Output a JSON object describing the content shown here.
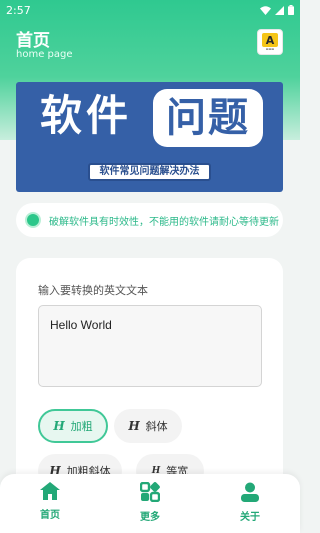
{
  "status_bar": {
    "time": "2:57"
  },
  "header": {
    "title": "首页",
    "subtitle": "home page",
    "logo_letter": "A"
  },
  "banner": {
    "main_left": "软件",
    "main_box": "问题",
    "subtitle": "软件常见问题解决办法"
  },
  "notice": {
    "text": "破解软件具有时效性，不能用的软件请耐心等待更新"
  },
  "converter": {
    "input_label": "输入要转换的英文文本",
    "input_value": "Hello World",
    "style_buttons": [
      {
        "glyph": "H",
        "label": "加粗",
        "selected": true
      },
      {
        "glyph": "H",
        "label": "斜体",
        "selected": false
      },
      {
        "glyph": "H",
        "label": "加粗斜体",
        "selected": false
      },
      {
        "glyph": "H",
        "label": "等宽",
        "selected": false
      }
    ]
  },
  "bottom_nav": {
    "items": [
      {
        "label": "首页",
        "icon": "home-icon"
      },
      {
        "label": "更多",
        "icon": "apps-icon"
      },
      {
        "label": "关于",
        "icon": "person-icon"
      }
    ]
  },
  "colors": {
    "accent": "#23a877",
    "banner": "#3560a7",
    "header_gradient_top": "#2fc990"
  }
}
